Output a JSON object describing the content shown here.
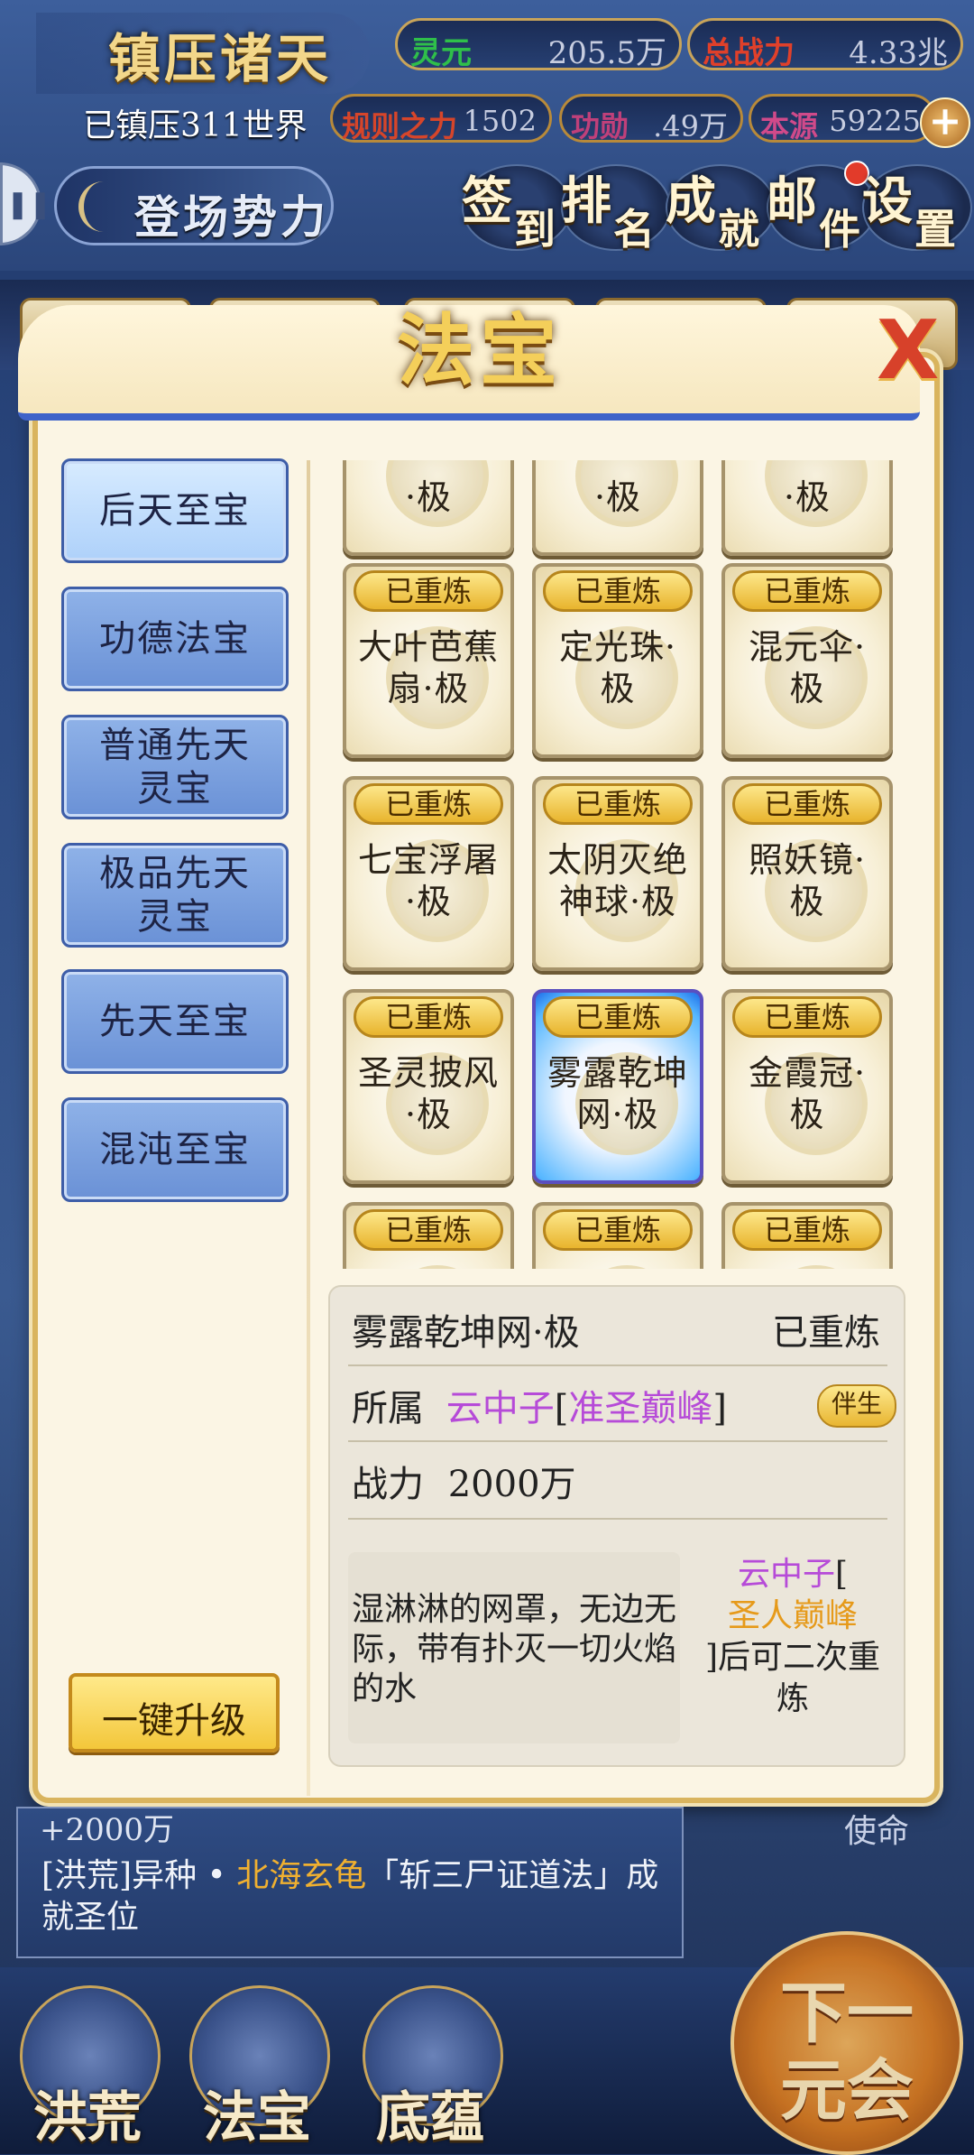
{
  "hud": {
    "title": "镇压诸天",
    "lingyuan_label": "灵元",
    "lingyuan_value": "205.5万",
    "power_label": "总战力",
    "power_value": "4.33兆",
    "realm": "已镇压311世界",
    "rule_label": "规则之力",
    "rule_value": "1502",
    "merit_label": "功勋",
    "merit_value": ".49万",
    "origin_label": "本源",
    "origin_value": "59225",
    "plus_label": "+",
    "side_tab_icon": "pause-icon",
    "faction_label": "登场势力",
    "buttons": [
      {
        "c1": "签",
        "c2": "到"
      },
      {
        "c1": "排",
        "c2": "名"
      },
      {
        "c1": "成",
        "c2": "就"
      },
      {
        "c1": "邮",
        "c2": "件"
      },
      {
        "c1": "设",
        "c2": "置"
      }
    ]
  },
  "dialog": {
    "title": "法宝",
    "close_label": "X",
    "categories": [
      {
        "label": "后天至宝",
        "active": true
      },
      {
        "label": "功德法宝"
      },
      {
        "label": "普通先天\n灵宝"
      },
      {
        "label": "极品先天\n灵宝"
      },
      {
        "label": "先天至宝"
      },
      {
        "label": "混沌至宝"
      }
    ],
    "upgrade_all_label": "一键升级",
    "items": [
      {
        "badge": "",
        "name": "·极"
      },
      {
        "badge": "",
        "name": "·极"
      },
      {
        "badge": "",
        "name": "·极"
      },
      {
        "badge": "已重炼",
        "name": "大叶芭蕉\n扇·极"
      },
      {
        "badge": "已重炼",
        "name": "定光珠·\n极"
      },
      {
        "badge": "已重炼",
        "name": "混元伞·\n极"
      },
      {
        "badge": "已重炼",
        "name": "七宝浮屠\n·极"
      },
      {
        "badge": "已重炼",
        "name": "太阴灭绝\n神球·极"
      },
      {
        "badge": "已重炼",
        "name": "照妖镜·\n极"
      },
      {
        "badge": "已重炼",
        "name": "圣灵披风\n·极"
      },
      {
        "badge": "已重炼",
        "name": "雾露乾坤\n网·极",
        "selected": true
      },
      {
        "badge": "已重炼",
        "name": "金霞冠·\n极"
      },
      {
        "badge": "已重炼",
        "name": ""
      },
      {
        "badge": "已重炼",
        "name": ""
      },
      {
        "badge": "已重炼",
        "name": ""
      }
    ],
    "detail": {
      "name": "雾露乾坤网·极",
      "status": "已重炼",
      "owner_label": "所属",
      "owner_name": "云中子",
      "owner_realm_open": "[",
      "owner_realm": "准圣巅峰",
      "owner_realm_close": "]",
      "bond_label": "伴生",
      "power_label": "战力",
      "power_value": "2000万",
      "description": "湿淋淋的网罩，无边无际，带有扑灭一切火焰的水",
      "note_name": "云中子",
      "note_open": "[",
      "note_realm": "圣人巅峰",
      "note_rest": "]后可二次重炼"
    }
  },
  "log": {
    "line1": "+2000万",
    "line2_pre": "[洪荒]异种 • ",
    "line2_hl": "北海玄龟",
    "line2_post": "「斩三尸证道法」成就圣位",
    "side_text": "使命"
  },
  "bottom_nav": [
    "洪荒",
    "法宝",
    "底蕴"
  ],
  "next_label": "下一\n元会",
  "colors": {
    "lingyuan": "#2fbf4a",
    "power": "#e0402a",
    "rule": "#d6452a",
    "merit": "#c0407a",
    "origin": "#d04a8a"
  }
}
